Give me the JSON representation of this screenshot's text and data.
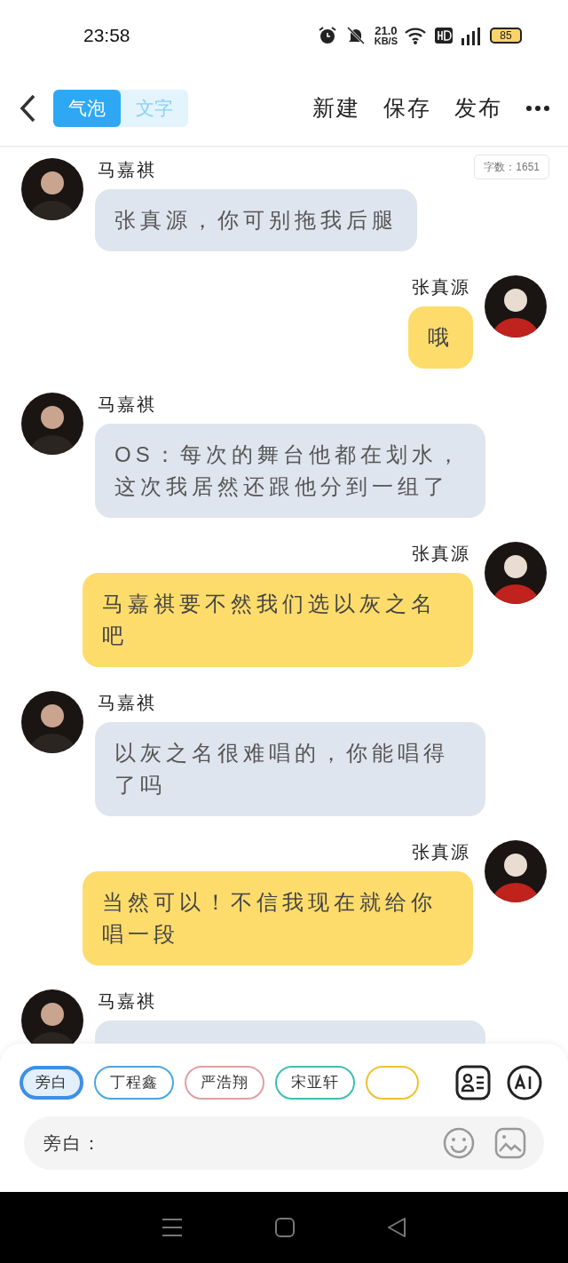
{
  "status_bar": {
    "time": "23:58",
    "net_speed": "21.0",
    "net_unit": "KB/S",
    "battery": "85"
  },
  "header": {
    "tabs": [
      {
        "label": "气泡",
        "selected": true
      },
      {
        "label": "文字",
        "selected": false
      }
    ],
    "actions": [
      "新建",
      "保存",
      "发布"
    ]
  },
  "word_count": {
    "label": "字数：",
    "value": "1651"
  },
  "messages": [
    {
      "kind": "received",
      "name": "马嘉祺",
      "text": "张真源，你可别拖我后腿"
    },
    {
      "kind": "sent",
      "name": "张真源",
      "text": "哦"
    },
    {
      "kind": "received",
      "name": "马嘉祺",
      "text": "OS：每次的舞台他都在划水，这次我居然还跟他分到一组了"
    },
    {
      "kind": "sent",
      "name": "张真源",
      "text": "马嘉祺要不然我们选以灰之名吧"
    },
    {
      "kind": "received",
      "name": "马嘉祺",
      "text": "以灰之名很难唱的，你能唱得了吗"
    },
    {
      "kind": "sent",
      "name": "张真源",
      "text": "当然可以！不信我现在就给你唱一段"
    },
    {
      "kind": "received",
      "name": "马嘉祺"
    }
  ],
  "characters": [
    {
      "label": "旁白",
      "selected": true,
      "color": "#3d8fe8"
    },
    {
      "label": "丁程鑫",
      "selected": false,
      "color": "#4aa6e0"
    },
    {
      "label": "严浩翔",
      "selected": false,
      "color": "#e0a0a3"
    },
    {
      "label": "宋亚轩",
      "selected": false,
      "color": "#3dbfb0"
    },
    {
      "selected": false,
      "color": "#f0c030"
    }
  ],
  "input": {
    "prefix": "旁白："
  }
}
